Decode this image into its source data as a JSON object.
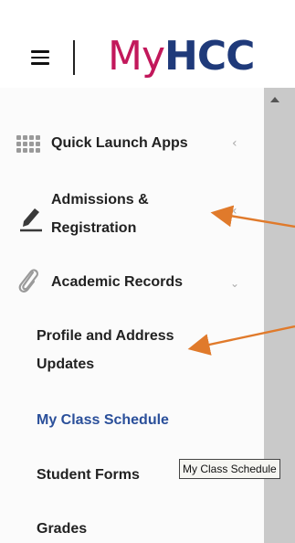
{
  "header": {
    "logo_my": "My",
    "logo_hcc": "HCC"
  },
  "menu": {
    "quick_launch": "Quick Launch Apps",
    "admissions_line1": "Admissions &",
    "admissions_line2": "Registration",
    "academic_records": "Academic Records",
    "profile_line1": "Profile and Address",
    "profile_line2": "Updates",
    "my_class_schedule": "My Class Schedule",
    "student_forms": "Student Forms",
    "grades": "Grades"
  },
  "tooltip": {
    "text": "My Class Schedule"
  },
  "colors": {
    "brand_pink": "#c2185b",
    "brand_navy": "#1f3a7a",
    "link_blue": "#2a4f9a",
    "arrow_orange": "#e07a2b"
  }
}
